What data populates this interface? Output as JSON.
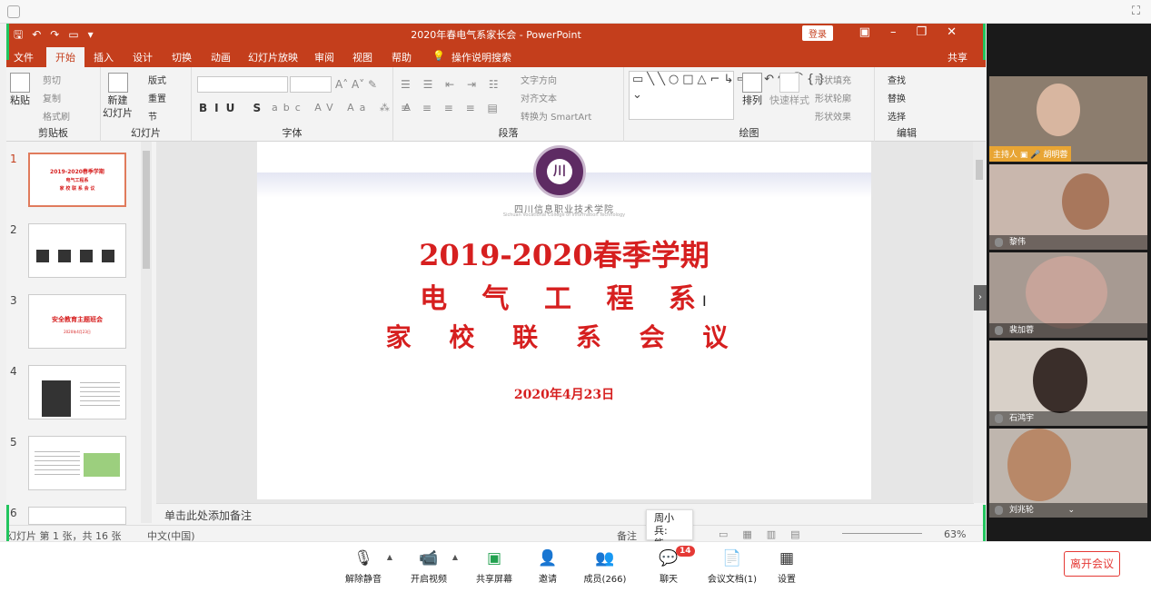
{
  "powerpoint": {
    "title": "2020年春电气系家长会  -  PowerPoint",
    "login": "登录",
    "tabs": [
      "文件",
      "开始",
      "插入",
      "设计",
      "切换",
      "动画",
      "幻灯片放映",
      "审阅",
      "视图",
      "帮助",
      "操作说明搜索"
    ],
    "share": "共享",
    "ribbon": {
      "clipboard": {
        "label": "剪贴板",
        "paste": "粘贴",
        "cut": "剪切",
        "copy": "复制",
        "format_painter": "格式刷"
      },
      "slides": {
        "label": "幻灯片",
        "new_slide": "新建\n幻灯片",
        "layout": "版式",
        "reset": "重置",
        "section": "节"
      },
      "font": {
        "label": "字体"
      },
      "paragraph": {
        "label": "段落",
        "text_direction": "文字方向",
        "align_text": "对齐文本",
        "smartart": "转换为 SmartArt"
      },
      "drawing": {
        "label": "绘图",
        "arrange": "排列",
        "quick_styles": "快速样式",
        "shape_fill": "形状填充",
        "shape_outline": "形状轮廓",
        "shape_effects": "形状效果"
      },
      "editing": {
        "label": "编辑",
        "find": "查找",
        "replace": "替换",
        "select": "选择"
      }
    },
    "slide_numbers": [
      "1",
      "2",
      "3",
      "4",
      "5",
      "6"
    ],
    "thumbs": {
      "t1_line1": "2019-2020春季学期",
      "t1_line2": "电气工程系",
      "t1_line3": "家 校 联 系 会 议",
      "t3_title": "安全教育主题班会",
      "t3_date": "2020年4月23日"
    },
    "slide": {
      "school": "四川信息职业技术学院",
      "school_en": "Sichuan Vocational College of Information Technology",
      "line1": "2019-2020春季学期",
      "line2": "电 气 工 程 系",
      "line3": "家 校 联 系 会 议",
      "date": "2020年4月23日"
    },
    "notes_placeholder": "单击此处添加备注",
    "status": {
      "slide_info": "幻灯片 第 1 张，共 16 张",
      "language": "中文(中国)",
      "notes": "备注",
      "zoom": "63%"
    }
  },
  "participants": [
    {
      "name": "胡明蓉",
      "host_label": "主持人"
    },
    {
      "name": "黎伟"
    },
    {
      "name": "裴加蓉"
    },
    {
      "name": "石鸿宇"
    },
    {
      "name": "刘兆轮"
    }
  ],
  "chat_popup": {
    "sender": "周小兵:",
    "message": "能"
  },
  "toolbar": {
    "mute": "解除静音",
    "video": "开启视频",
    "share": "共享屏幕",
    "invite": "邀请",
    "members": "成员(266)",
    "chat": "聊天",
    "chat_badge": "14",
    "docs": "会议文档(1)",
    "settings": "设置",
    "leave": "离开会议"
  },
  "colors": {
    "ppt_red": "#c43e1c",
    "slide_red": "#d61f1f",
    "logo_purple": "#5e2b63",
    "green_border": "#22c55e"
  }
}
